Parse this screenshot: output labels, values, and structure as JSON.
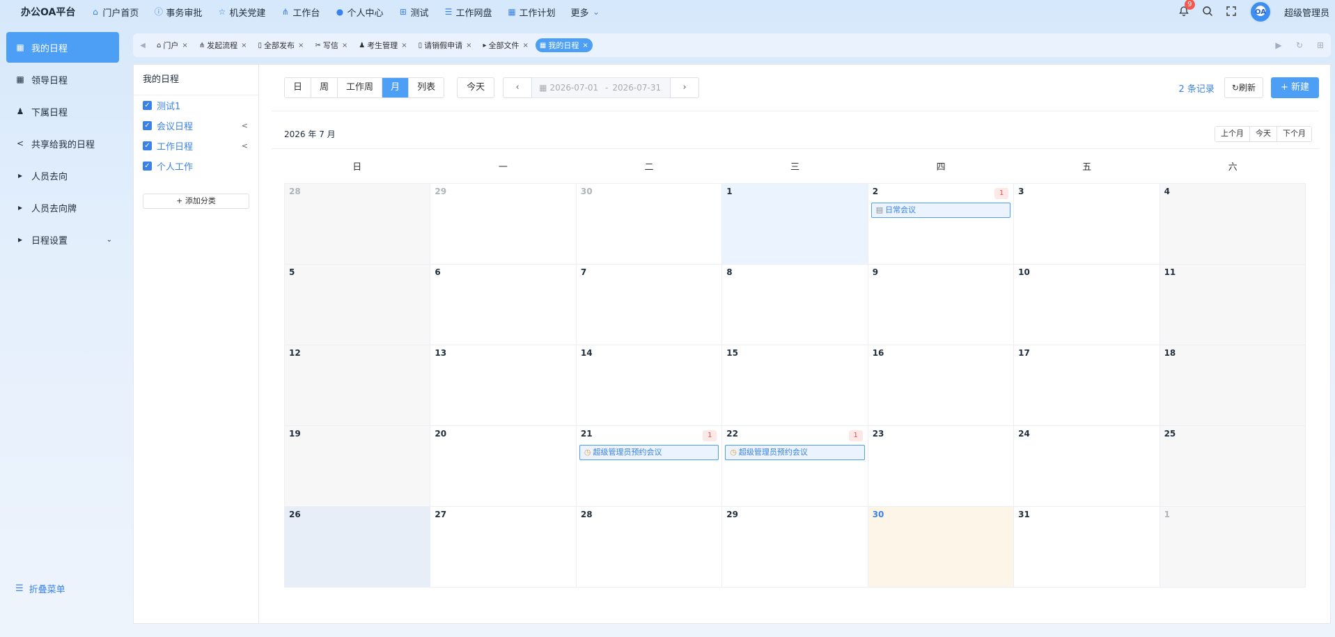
{
  "app": {
    "brand": "办公OA平台",
    "user": "超级管理员",
    "notification_count": "9",
    "avatar_text": "OA"
  },
  "topnav": [
    {
      "label": "门户首页",
      "icon": "home-icon"
    },
    {
      "label": "事务审批",
      "icon": "info-icon"
    },
    {
      "label": "机关党建",
      "icon": "star-icon"
    },
    {
      "label": "工作台",
      "icon": "org-icon"
    },
    {
      "label": "个人中心",
      "icon": "user-icon"
    },
    {
      "label": "测试",
      "icon": "grid-icon"
    },
    {
      "label": "工作网盘",
      "icon": "database-icon"
    },
    {
      "label": "工作计划",
      "icon": "calendar-icon"
    },
    {
      "label": "更多",
      "icon": "chevron-down-icon"
    }
  ],
  "sidebar": {
    "items": [
      {
        "label": "我的日程",
        "icon": "calendar-icon",
        "active": true
      },
      {
        "label": "领导日程",
        "icon": "calendar-icon"
      },
      {
        "label": "下属日程",
        "icon": "user-icon"
      },
      {
        "label": "共享给我的日程",
        "icon": "share-icon"
      },
      {
        "label": "人员去向",
        "icon": "caret-right-icon"
      },
      {
        "label": "人员去向牌",
        "icon": "caret-right-icon"
      },
      {
        "label": "日程设置",
        "icon": "caret-right-icon"
      }
    ],
    "collapse_label": "折叠菜单"
  },
  "tabs": [
    {
      "label": "门户",
      "icon": "home-icon"
    },
    {
      "label": "发起流程",
      "icon": "org-icon"
    },
    {
      "label": "全部发布",
      "icon": "doc-icon"
    },
    {
      "label": "写信",
      "icon": "tools-icon"
    },
    {
      "label": "考生管理",
      "icon": "user-icon"
    },
    {
      "label": "请销假申请",
      "icon": "doc-icon"
    },
    {
      "label": "全部文件",
      "icon": "caret-right-icon"
    },
    {
      "label": "我的日程",
      "icon": "calendar-icon",
      "active": true
    }
  ],
  "categories": {
    "title": "我的日程",
    "items": [
      {
        "label": "测试1",
        "checked": true,
        "shared": false
      },
      {
        "label": "会议日程",
        "checked": true,
        "shared": true
      },
      {
        "label": "工作日程",
        "checked": true,
        "shared": true
      },
      {
        "label": "个人工作",
        "checked": true,
        "shared": false
      }
    ],
    "add_label": "+ 添加分类"
  },
  "toolbar": {
    "views": [
      "日",
      "周",
      "工作周",
      "月",
      "列表"
    ],
    "active_view": "月",
    "today_label": "今天",
    "range_start": "2026-07-01",
    "range_sep": "-",
    "range_end": "2026-07-31",
    "records": "2 条记录",
    "refresh_label": "刷新",
    "new_label": "+ 新建"
  },
  "calendar": {
    "month_title": "2026 年 7 月",
    "prev_month": "上个月",
    "today": "今天",
    "next_month": "下个月",
    "weekdays": [
      "日",
      "一",
      "二",
      "三",
      "四",
      "五",
      "六"
    ],
    "days": [
      {
        "d": "28",
        "state": "other"
      },
      {
        "d": "29",
        "state": "other"
      },
      {
        "d": "30",
        "state": "other"
      },
      {
        "d": "1",
        "state": "today"
      },
      {
        "d": "2",
        "count": "1",
        "event": {
          "title": "日常会议",
          "icon": "meeting-icon"
        }
      },
      {
        "d": "3"
      },
      {
        "d": "4"
      },
      {
        "d": "5"
      },
      {
        "d": "6"
      },
      {
        "d": "7"
      },
      {
        "d": "8"
      },
      {
        "d": "9"
      },
      {
        "d": "10"
      },
      {
        "d": "11"
      },
      {
        "d": "12"
      },
      {
        "d": "13"
      },
      {
        "d": "14"
      },
      {
        "d": "15"
      },
      {
        "d": "16"
      },
      {
        "d": "17"
      },
      {
        "d": "18"
      },
      {
        "d": "19"
      },
      {
        "d": "20"
      },
      {
        "d": "21",
        "count": "1",
        "event": {
          "title": "超级管理员预约会议",
          "icon": "clock-icon"
        }
      },
      {
        "d": "22",
        "count": "1",
        "event": {
          "title": "超级管理员预约会议",
          "icon": "clock-icon"
        }
      },
      {
        "d": "23"
      },
      {
        "d": "24"
      },
      {
        "d": "25"
      },
      {
        "d": "26",
        "state": "selected"
      },
      {
        "d": "27"
      },
      {
        "d": "28"
      },
      {
        "d": "29"
      },
      {
        "d": "30",
        "state": "holiday"
      },
      {
        "d": "31"
      },
      {
        "d": "1",
        "state": "other"
      }
    ]
  },
  "colors": {
    "accent": "#4c9ff4",
    "link": "#3b82e8",
    "badge": "#f5584e"
  }
}
